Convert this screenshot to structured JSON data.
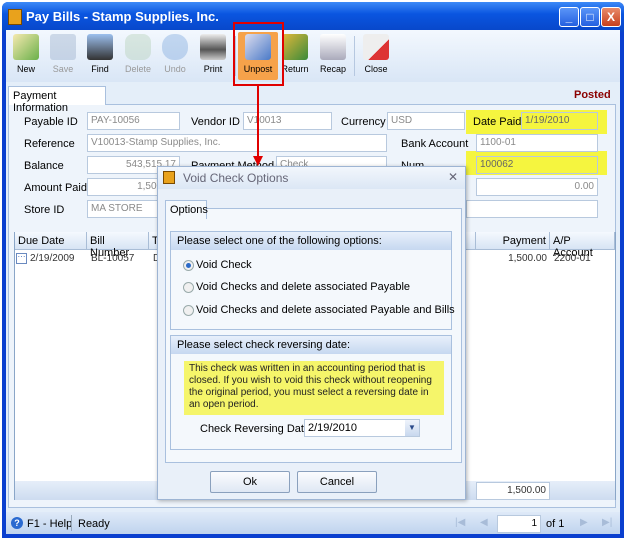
{
  "window": {
    "title": "Pay Bills - Stamp Supplies, Inc.",
    "minimize": "_",
    "maximize": "□",
    "close": "X"
  },
  "toolbar": {
    "items": [
      {
        "label": "New",
        "enabled": true
      },
      {
        "label": "Save",
        "enabled": false
      },
      {
        "label": "Find",
        "enabled": true
      },
      {
        "label": "Delete",
        "enabled": false
      },
      {
        "label": "Undo",
        "enabled": false
      },
      {
        "label": "Print",
        "enabled": true
      },
      {
        "label": "Unpost",
        "enabled": true,
        "highlighted": true
      },
      {
        "label": "Return",
        "enabled": true
      },
      {
        "label": "Recap",
        "enabled": true
      },
      {
        "label": "Close",
        "enabled": true
      }
    ]
  },
  "tab": {
    "label": "Payment Information",
    "status": "Posted"
  },
  "form": {
    "payable_id": {
      "label": "Payable ID",
      "value": "PAY-10056"
    },
    "vendor_id": {
      "label": "Vendor ID",
      "value": "V10013"
    },
    "currency": {
      "label": "Currency",
      "value": "USD"
    },
    "date_paid": {
      "label": "Date Paid",
      "value": "1/19/2010"
    },
    "reference": {
      "label": "Reference",
      "value": "V10013-Stamp Supplies, Inc."
    },
    "bank_account": {
      "label": "Bank Account",
      "value": "1100-01"
    },
    "balance": {
      "label": "Balance",
      "value": "543,515.17"
    },
    "payment_method": {
      "label": "Payment Method",
      "value": "Check"
    },
    "num": {
      "label": "Num",
      "value": "100062"
    },
    "amount_paid": {
      "label": "Amount Paid",
      "value": "1,500.00"
    },
    "unapplied": {
      "value": "0.00"
    },
    "store_id": {
      "label": "Store ID",
      "value": "MA STORE"
    }
  },
  "grid": {
    "columns": [
      "Due Date",
      "Bill Number",
      "Te",
      "Payment",
      "A/P Account"
    ],
    "rows": [
      {
        "due_date": "2/19/2009",
        "bill_number": "BL-10057",
        "terms": "D",
        "payment": "1,500.00",
        "ap_account": "2200-01"
      }
    ],
    "total_payment": "1,500.00"
  },
  "status": {
    "help": "F1 - Help",
    "text": "Ready",
    "page": "1",
    "of": "of 1"
  },
  "dialog": {
    "title": "Void Check Options",
    "tab": "Options",
    "group1_title": "Please select one of the following options:",
    "options": [
      {
        "label": "Void Check",
        "selected": true
      },
      {
        "label": "Void Checks and delete associated Payable",
        "selected": false
      },
      {
        "label": "Void Checks and delete associated Payable and Bills",
        "selected": false
      }
    ],
    "group2_title": "Please select check reversing date:",
    "warning": "This check was written in an accounting period that is closed. If you wish to void this check without reopening the original period, you must select a reversing date in an open period.",
    "date_label": "Check Reversing Date",
    "date_value": "2/19/2010",
    "ok": "Ok",
    "cancel": "Cancel"
  },
  "colors": {
    "highlight": "#f5f53f",
    "annotation": "#e00000",
    "posted": "#8b0000"
  }
}
